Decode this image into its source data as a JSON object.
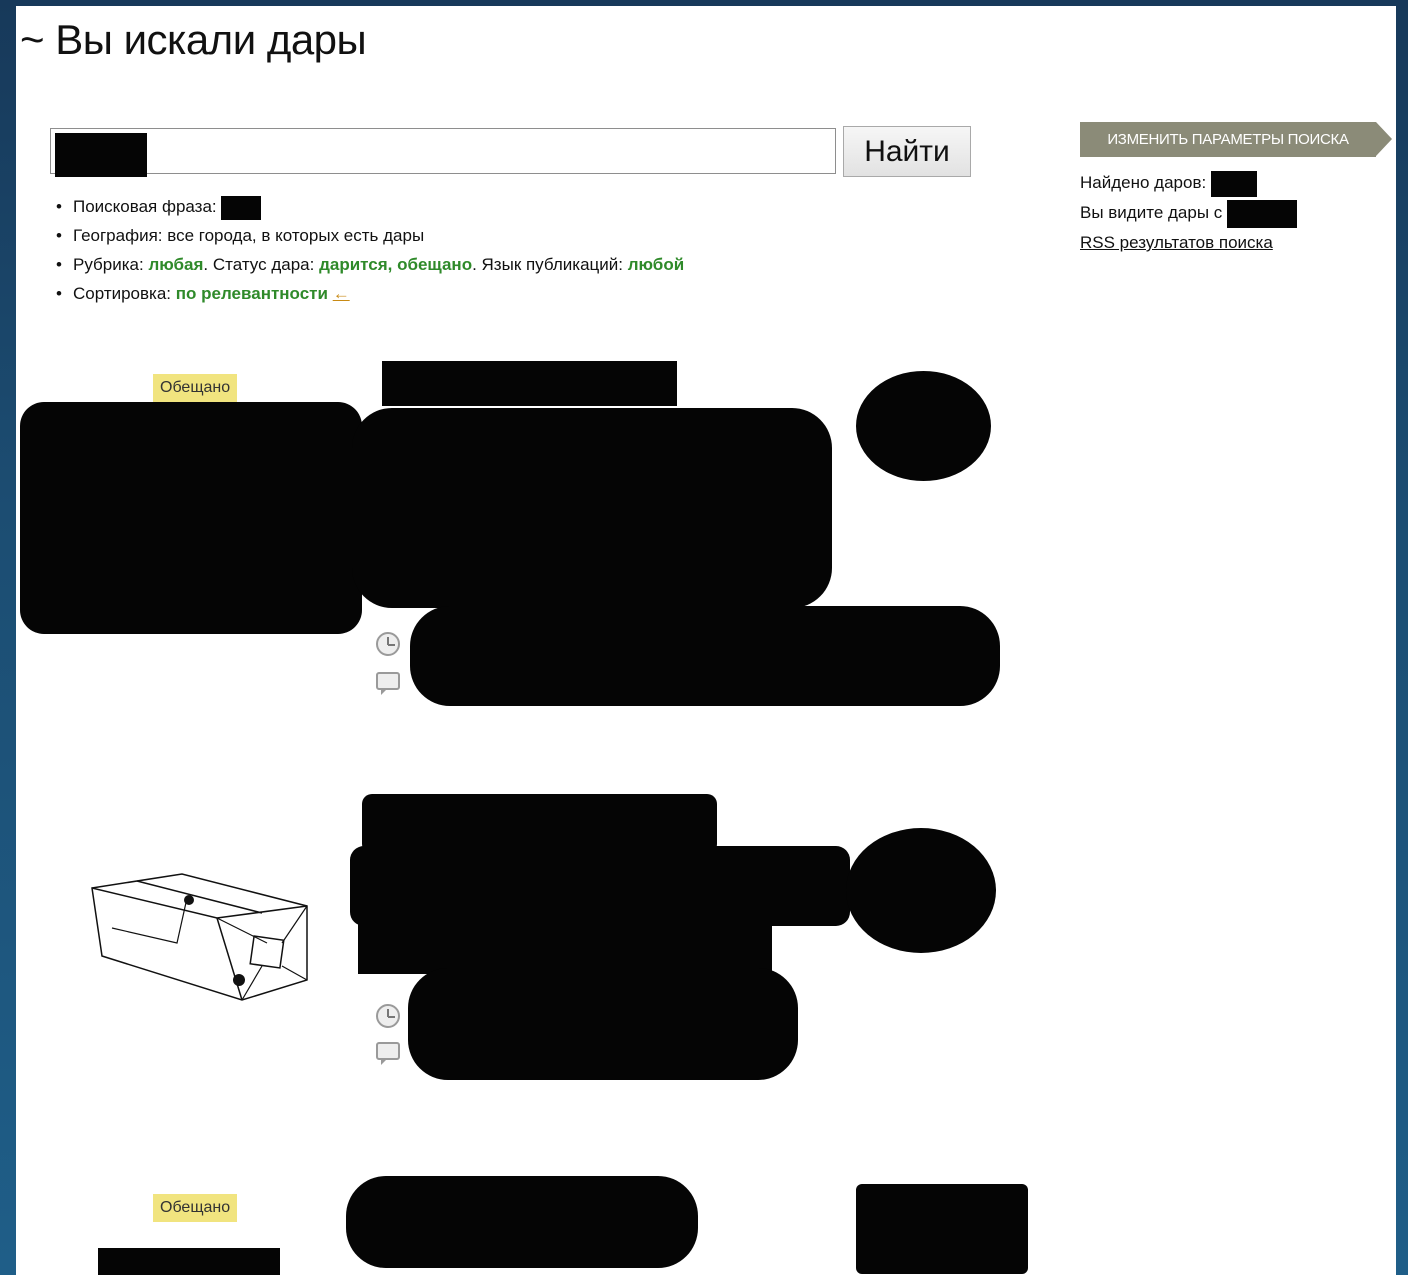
{
  "page": {
    "title": "~ Вы искали дары"
  },
  "search": {
    "button_label": "Найти",
    "value": ""
  },
  "params": {
    "phrase_label": "Поисковая фраза:",
    "geography": "География: все города, в которых есть дары",
    "rubric_label": "Рубрика:",
    "rubric_value": "любая",
    "status_label": ". Статус дара:",
    "status_value": "дарится, обещано",
    "language_label": ". Язык публикаций:",
    "language_value": "любой",
    "sort_label": "Сортировка:",
    "sort_value": "по релевантности",
    "sort_arrow": "←"
  },
  "sidebar": {
    "change_params_label": "ИЗМЕНИТЬ ПАРАМЕТРЫ ПОИСКА",
    "found_label": "Найдено даров:",
    "showing_label": "Вы видите дары с",
    "rss_label": "RSS результатов поиска"
  },
  "results": [
    {
      "status": "Обещано"
    },
    {
      "status": ""
    },
    {
      "status": "Обещано"
    }
  ],
  "icons": [
    "clock-icon",
    "comment-icon",
    "gift-box-icon"
  ],
  "colors": {
    "accent_green": "#2f8a2a",
    "badge_yellow": "#f1e47f",
    "sidebar_tab": "#8b8b78"
  }
}
